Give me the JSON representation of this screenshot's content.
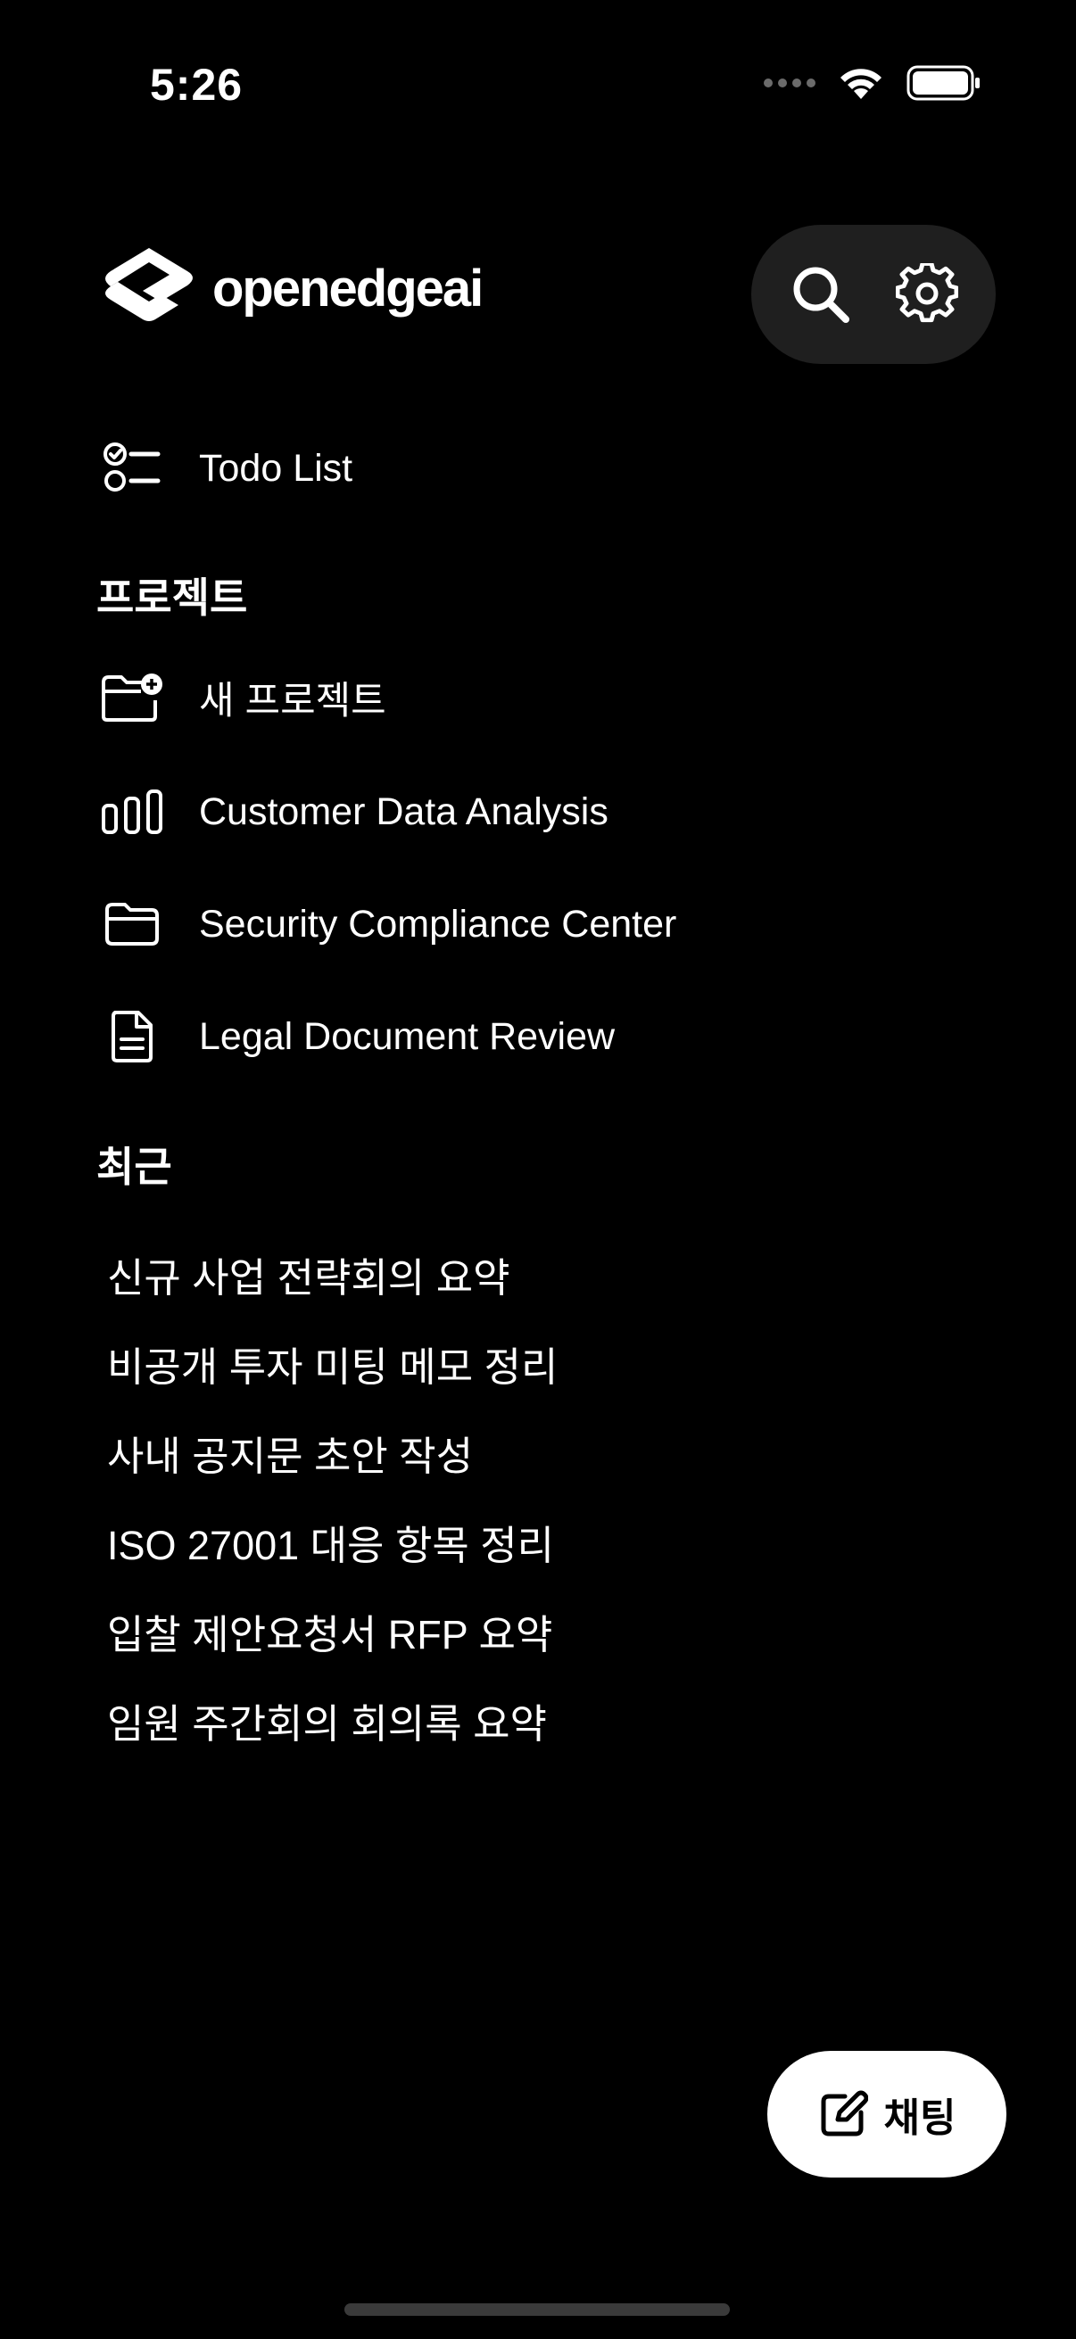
{
  "status_bar": {
    "time": "5:26"
  },
  "header": {
    "logo_text": "openedgeai",
    "search_icon": "search-icon",
    "settings_icon": "gear-icon"
  },
  "todo": {
    "label": "Todo List",
    "icon": "checklist-icon"
  },
  "projects": {
    "title": "프로젝트",
    "new_label": "새 프로젝트",
    "items": [
      {
        "label": "Customer Data Analysis",
        "icon": "bar-chart-icon"
      },
      {
        "label": "Security Compliance Center",
        "icon": "folder-icon"
      },
      {
        "label": "Legal Document Review",
        "icon": "document-icon"
      }
    ]
  },
  "recent": {
    "title": "최근",
    "items": [
      "신규 사업 전략회의 요약",
      "비공개 투자 미팅 메모 정리",
      "사내 공지문 초안 작성",
      "ISO 27001 대응 항목 정리",
      "입찰 제안요청서 RFP 요약",
      "임원 주간회의 회의록 요약"
    ]
  },
  "chat_button": {
    "label": "채팅",
    "icon": "compose-icon"
  },
  "colors": {
    "background": "#000000",
    "pill_background": "#1f1f1f",
    "text": "#ffffff"
  }
}
